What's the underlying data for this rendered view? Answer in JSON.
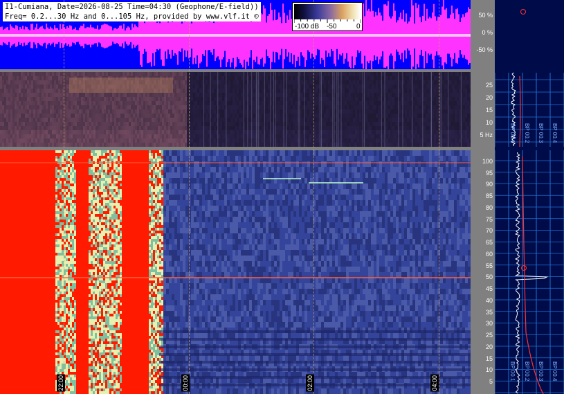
{
  "header": {
    "line1": "I1-Cumiana, Date=2026-08-25 Time=04:30 (Geophone/E-field))",
    "line2": "Freq= 0.2...30 Hz and 0...105 Hz, provided by www.vlf.it ©"
  },
  "colorbar": {
    "labels": [
      "-100 dB",
      "-50",
      "0"
    ],
    "colors": [
      "#000000",
      "#3a3a9a",
      "#d9a060",
      "#ffffff"
    ]
  },
  "amplitude_axis": {
    "ticks": [
      "50 %",
      "0 %",
      "-50 %"
    ]
  },
  "low_freq_axis": {
    "ticks": [
      "25",
      "20",
      "15",
      "10",
      "5 Hz"
    ]
  },
  "high_freq_axis": {
    "ticks": [
      "100",
      "95",
      "90",
      "85",
      "80",
      "75",
      "70",
      "65",
      "60",
      "55",
      "50",
      "45",
      "40",
      "35",
      "30",
      "25",
      "20",
      "15",
      "10",
      "5"
    ]
  },
  "time_markers": [
    "22:00",
    "00:00",
    "02:00",
    "04:00"
  ],
  "side_panel": {
    "upper_labels": [
      "BP 00.1",
      "BP 00.2",
      "BP 00.3",
      "BP 00.4"
    ],
    "lower_labels": [
      "BP 00.1",
      "BP 00.2",
      "BP 00.3",
      "BP 00.4"
    ]
  },
  "colors": {
    "amplitude_bg": "#0000ff",
    "amplitude_trace": "#ff33ff",
    "saturation": "#ff1a00",
    "background_noise": "#2c3a86",
    "axis_gray": "#808080",
    "side_bg": "#000c4a",
    "side_trace": "#ffffff",
    "side_fit": "#ff3030"
  }
}
